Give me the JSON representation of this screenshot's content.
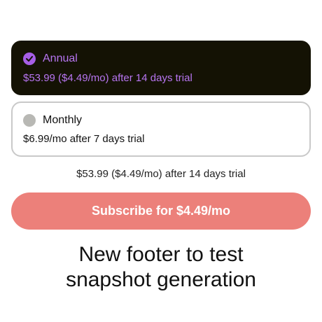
{
  "plans": {
    "annual": {
      "title": "Annual",
      "detail": "$53.99 ($4.49/mo) after 14 days trial",
      "selected": true
    },
    "monthly": {
      "title": "Monthly",
      "detail": "$6.99/mo after 7 days trial",
      "selected": false
    }
  },
  "summary": "$53.99 ($4.49/mo) after 14 days trial",
  "subscribe_label": "Subscribe for $4.49/mo",
  "footer": {
    "line1": "New footer to test",
    "line2": "snapshot generation"
  },
  "colors": {
    "accent": "#a65ee6",
    "selected_background": "#141204",
    "button": "#ec807a"
  },
  "icons": {
    "selected": "checkmark-circle-icon",
    "unselected": "empty-circle-icon"
  }
}
